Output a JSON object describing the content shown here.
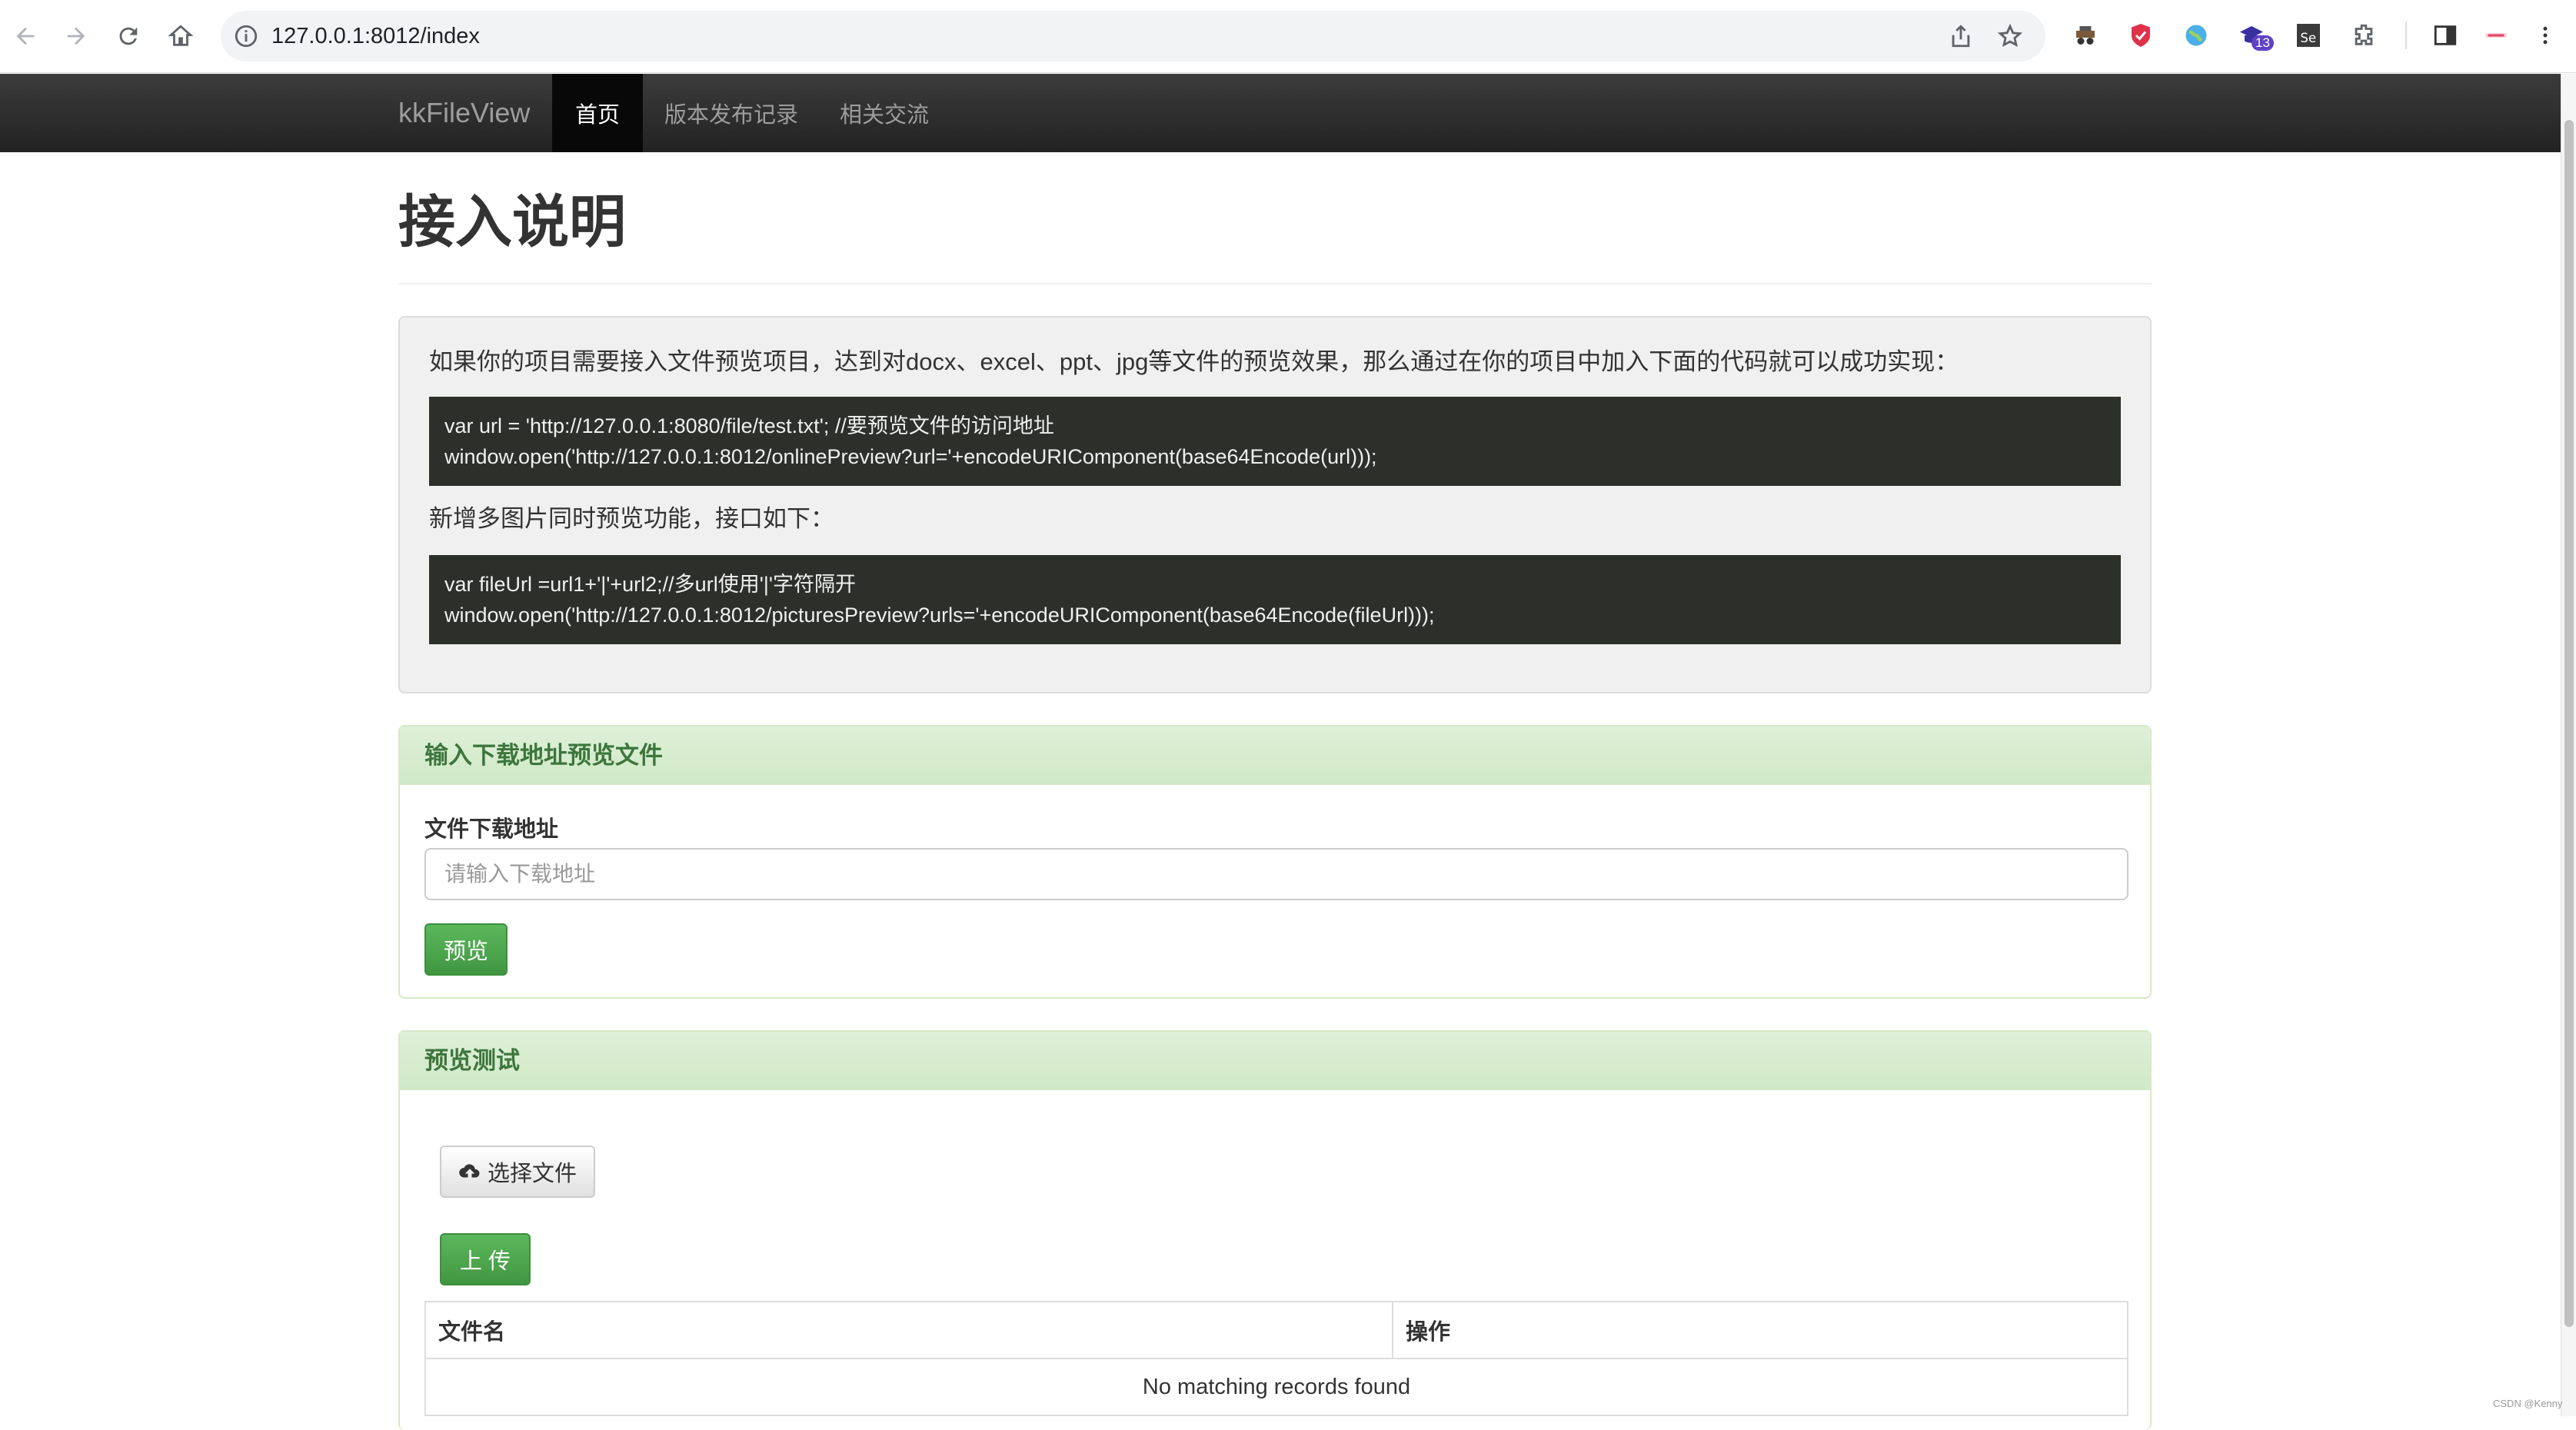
{
  "browser": {
    "url": "127.0.0.1:8012/index",
    "badge_count": "13"
  },
  "navbar": {
    "brand": "kkFileView",
    "items": [
      {
        "label": "首页"
      },
      {
        "label": "版本发布记录"
      },
      {
        "label": "相关交流"
      }
    ]
  },
  "page": {
    "title": "接入说明"
  },
  "well": {
    "intro": "如果你的项目需要接入文件预览项目，达到对docx、excel、ppt、jpg等文件的预览效果，那么通过在你的项目中加入下面的代码就可以成功实现：",
    "code1_line1": "var url = 'http://127.0.0.1:8080/file/test.txt'; //要预览文件的访问地址",
    "code1_line2": "window.open('http://127.0.0.1:8012/onlinePreview?url='+encodeURIComponent(base64Encode(url)));",
    "multi_intro": "新增多图片同时预览功能，接口如下：",
    "code2_line1": "var fileUrl =url1+'|'+url2;//多url使用'|'字符隔开",
    "code2_line2": "window.open('http://127.0.0.1:8012/picturesPreview?urls='+encodeURIComponent(base64Encode(fileUrl)));"
  },
  "download_panel": {
    "heading": "输入下载地址预览文件",
    "field_label": "文件下载地址",
    "placeholder": "请输入下载地址",
    "value": "",
    "preview_button": "预览"
  },
  "test_panel": {
    "heading": "预览测试",
    "choose_file_button": "选择文件",
    "upload_button": "上 传",
    "table": {
      "columns": [
        "文件名",
        "操作"
      ],
      "empty_message": "No matching records found"
    }
  },
  "footer": {
    "watermark": "CSDN @Kenny"
  },
  "colors": {
    "navbar_bg": "#222222",
    "accent_green": "#5cb85c",
    "panel_heading_text": "#3c763d"
  }
}
